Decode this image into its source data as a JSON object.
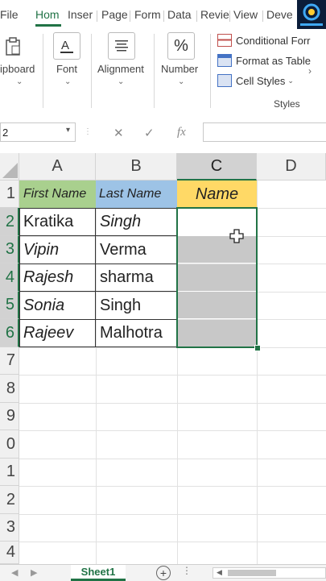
{
  "ribbon_tabs": {
    "file": "File",
    "home": "Hom",
    "insert": "Inser",
    "page": "Page",
    "formulas": "Form",
    "data": "Data",
    "review": "Revie",
    "view": "View",
    "developer": "Deve"
  },
  "ribbon": {
    "clipboard_label": "ipboard",
    "font_label": "Font",
    "alignment_label": "Alignment",
    "number_label": "Number",
    "number_icon": "%",
    "conditional_formatting": "Conditional Forr",
    "format_as_table": "Format as Table",
    "cell_styles": "Cell Styles",
    "styles_group": "Styles"
  },
  "formula_bar": {
    "name_box": "2",
    "fx": "fx"
  },
  "columns": [
    "A",
    "B",
    "C",
    "D"
  ],
  "rows": [
    "1",
    "2",
    "3",
    "4",
    "5",
    "6",
    "7",
    "8",
    "9",
    "0",
    "1",
    "2",
    "3",
    "4"
  ],
  "table": {
    "headers": [
      "First Name",
      "Last Name",
      "Name"
    ],
    "data": [
      {
        "first": "Kratika",
        "last": "Singh"
      },
      {
        "first": "Vipin",
        "last": "Verma"
      },
      {
        "first": "Rajesh",
        "last": "sharma"
      },
      {
        "first": "Sonia",
        "last": "Singh"
      },
      {
        "first": "Rajeev",
        "last": "Malhotra"
      }
    ]
  },
  "colors": {
    "accent": "#217346",
    "header_a": "#a9d08e",
    "header_b": "#9dc3e6",
    "header_c": "#ffd966",
    "selection": "#c8c8c8"
  },
  "sheets": {
    "active": "Sheet1"
  }
}
